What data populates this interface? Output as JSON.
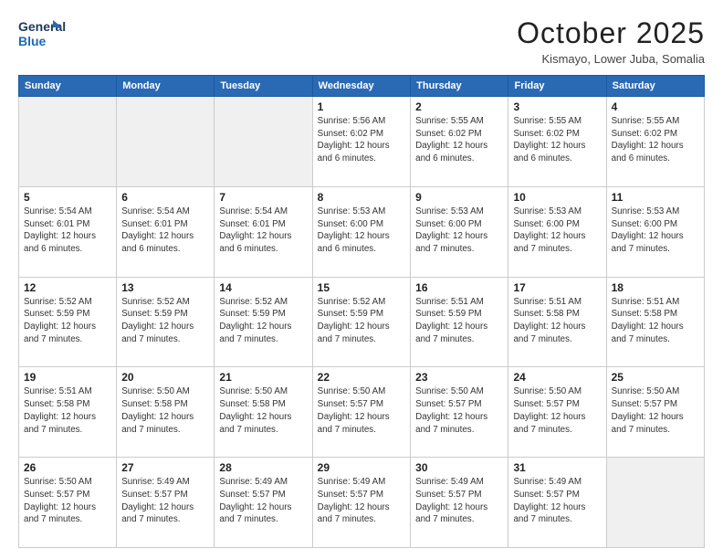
{
  "header": {
    "logo_line1": "General",
    "logo_line2": "Blue",
    "month": "October 2025",
    "location": "Kismayo, Lower Juba, Somalia"
  },
  "days_of_week": [
    "Sunday",
    "Monday",
    "Tuesday",
    "Wednesday",
    "Thursday",
    "Friday",
    "Saturday"
  ],
  "weeks": [
    [
      {
        "day": "",
        "empty": true
      },
      {
        "day": "",
        "empty": true
      },
      {
        "day": "",
        "empty": true
      },
      {
        "day": "1",
        "sunrise": "5:56 AM",
        "sunset": "6:02 PM",
        "daylight": "12 hours and 6 minutes."
      },
      {
        "day": "2",
        "sunrise": "5:55 AM",
        "sunset": "6:02 PM",
        "daylight": "12 hours and 6 minutes."
      },
      {
        "day": "3",
        "sunrise": "5:55 AM",
        "sunset": "6:02 PM",
        "daylight": "12 hours and 6 minutes."
      },
      {
        "day": "4",
        "sunrise": "5:55 AM",
        "sunset": "6:02 PM",
        "daylight": "12 hours and 6 minutes."
      }
    ],
    [
      {
        "day": "5",
        "sunrise": "5:54 AM",
        "sunset": "6:01 PM",
        "daylight": "12 hours and 6 minutes."
      },
      {
        "day": "6",
        "sunrise": "5:54 AM",
        "sunset": "6:01 PM",
        "daylight": "12 hours and 6 minutes."
      },
      {
        "day": "7",
        "sunrise": "5:54 AM",
        "sunset": "6:01 PM",
        "daylight": "12 hours and 6 minutes."
      },
      {
        "day": "8",
        "sunrise": "5:53 AM",
        "sunset": "6:00 PM",
        "daylight": "12 hours and 6 minutes."
      },
      {
        "day": "9",
        "sunrise": "5:53 AM",
        "sunset": "6:00 PM",
        "daylight": "12 hours and 7 minutes."
      },
      {
        "day": "10",
        "sunrise": "5:53 AM",
        "sunset": "6:00 PM",
        "daylight": "12 hours and 7 minutes."
      },
      {
        "day": "11",
        "sunrise": "5:53 AM",
        "sunset": "6:00 PM",
        "daylight": "12 hours and 7 minutes."
      }
    ],
    [
      {
        "day": "12",
        "sunrise": "5:52 AM",
        "sunset": "5:59 PM",
        "daylight": "12 hours and 7 minutes."
      },
      {
        "day": "13",
        "sunrise": "5:52 AM",
        "sunset": "5:59 PM",
        "daylight": "12 hours and 7 minutes."
      },
      {
        "day": "14",
        "sunrise": "5:52 AM",
        "sunset": "5:59 PM",
        "daylight": "12 hours and 7 minutes."
      },
      {
        "day": "15",
        "sunrise": "5:52 AM",
        "sunset": "5:59 PM",
        "daylight": "12 hours and 7 minutes."
      },
      {
        "day": "16",
        "sunrise": "5:51 AM",
        "sunset": "5:59 PM",
        "daylight": "12 hours and 7 minutes."
      },
      {
        "day": "17",
        "sunrise": "5:51 AM",
        "sunset": "5:58 PM",
        "daylight": "12 hours and 7 minutes."
      },
      {
        "day": "18",
        "sunrise": "5:51 AM",
        "sunset": "5:58 PM",
        "daylight": "12 hours and 7 minutes."
      }
    ],
    [
      {
        "day": "19",
        "sunrise": "5:51 AM",
        "sunset": "5:58 PM",
        "daylight": "12 hours and 7 minutes."
      },
      {
        "day": "20",
        "sunrise": "5:50 AM",
        "sunset": "5:58 PM",
        "daylight": "12 hours and 7 minutes."
      },
      {
        "day": "21",
        "sunrise": "5:50 AM",
        "sunset": "5:58 PM",
        "daylight": "12 hours and 7 minutes."
      },
      {
        "day": "22",
        "sunrise": "5:50 AM",
        "sunset": "5:57 PM",
        "daylight": "12 hours and 7 minutes."
      },
      {
        "day": "23",
        "sunrise": "5:50 AM",
        "sunset": "5:57 PM",
        "daylight": "12 hours and 7 minutes."
      },
      {
        "day": "24",
        "sunrise": "5:50 AM",
        "sunset": "5:57 PM",
        "daylight": "12 hours and 7 minutes."
      },
      {
        "day": "25",
        "sunrise": "5:50 AM",
        "sunset": "5:57 PM",
        "daylight": "12 hours and 7 minutes."
      }
    ],
    [
      {
        "day": "26",
        "sunrise": "5:50 AM",
        "sunset": "5:57 PM",
        "daylight": "12 hours and 7 minutes."
      },
      {
        "day": "27",
        "sunrise": "5:49 AM",
        "sunset": "5:57 PM",
        "daylight": "12 hours and 7 minutes."
      },
      {
        "day": "28",
        "sunrise": "5:49 AM",
        "sunset": "5:57 PM",
        "daylight": "12 hours and 7 minutes."
      },
      {
        "day": "29",
        "sunrise": "5:49 AM",
        "sunset": "5:57 PM",
        "daylight": "12 hours and 7 minutes."
      },
      {
        "day": "30",
        "sunrise": "5:49 AM",
        "sunset": "5:57 PM",
        "daylight": "12 hours and 7 minutes."
      },
      {
        "day": "31",
        "sunrise": "5:49 AM",
        "sunset": "5:57 PM",
        "daylight": "12 hours and 7 minutes."
      },
      {
        "day": "",
        "empty": true
      }
    ]
  ]
}
